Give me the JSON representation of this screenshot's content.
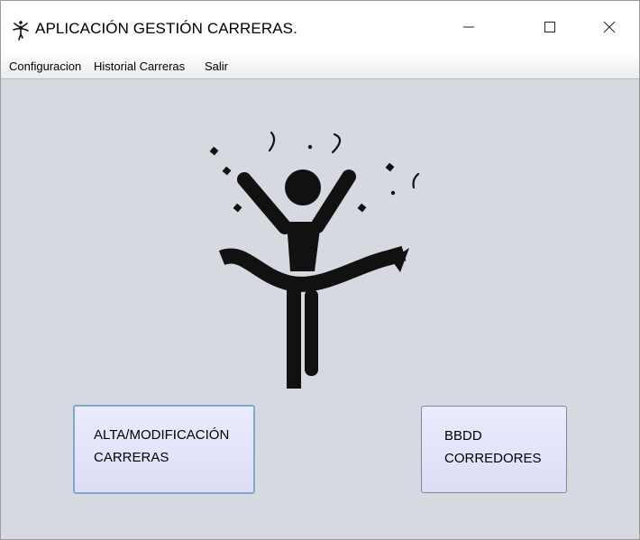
{
  "window": {
    "title": "APLICACIÓN GESTIÓN CARRERAS.",
    "app_icon": "runner-logo-icon",
    "controls": {
      "minimize_icon": "minimize-icon",
      "maximize_icon": "maximize-icon",
      "close_icon": "close-icon"
    }
  },
  "menubar": {
    "items": [
      {
        "label": "Configuracion"
      },
      {
        "label": "Historial Carreras"
      },
      {
        "label": "Salir"
      }
    ]
  },
  "main": {
    "hero_image": "finish-line-runner-icon",
    "buttons": {
      "alta": {
        "line1": "ALTA/MODIFICACIÓN",
        "line2": "CARRERAS"
      },
      "bbdd": {
        "line1": "BBDD",
        "line2": "CORREDORES"
      }
    }
  },
  "colors": {
    "background": "#d6d9df",
    "button_fill": "#e4e4fb",
    "focus_border": "#7fa8cf",
    "icon": "#111111"
  }
}
